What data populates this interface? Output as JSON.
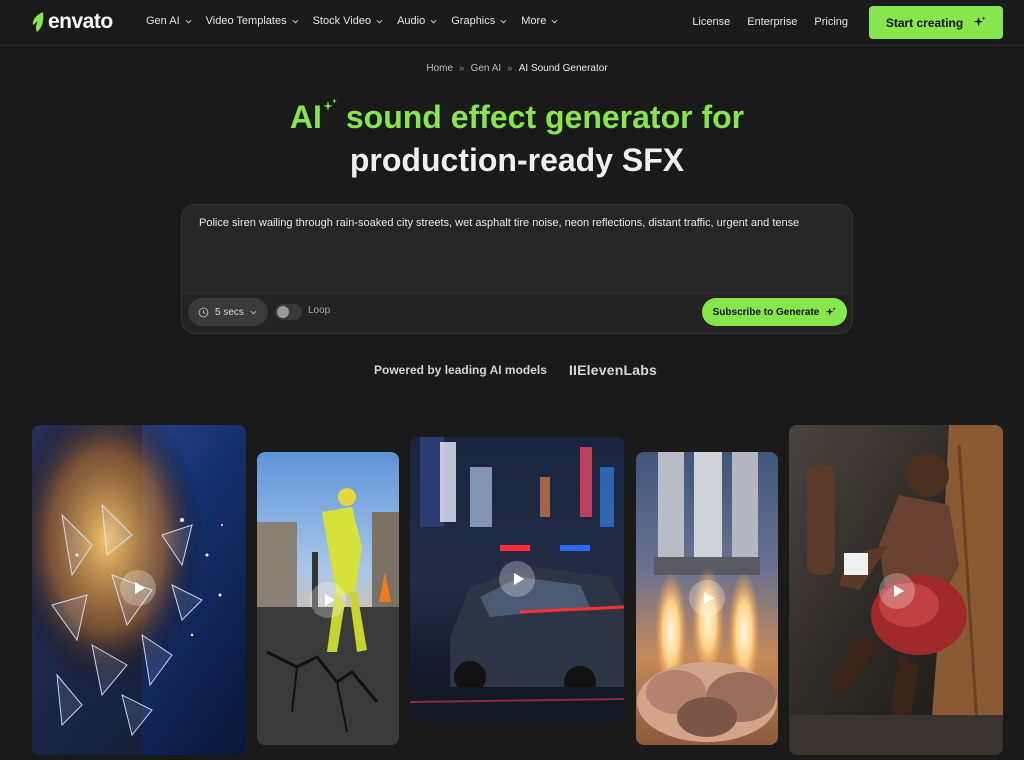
{
  "brand": {
    "name": "envato",
    "accent": "#87e64b"
  },
  "nav": {
    "menu": [
      {
        "label": "Gen AI",
        "icon": "chevron-down-icon"
      },
      {
        "label": "Video Templates",
        "icon": "chevron-down-icon"
      },
      {
        "label": "Stock Video",
        "icon": "chevron-down-icon"
      },
      {
        "label": "Audio",
        "icon": "chevron-down-icon"
      },
      {
        "label": "Graphics",
        "icon": "chevron-down-icon"
      },
      {
        "label": "More",
        "icon": "chevron-down-icon"
      }
    ],
    "links": [
      "License",
      "Enterprise",
      "Pricing"
    ],
    "cta": {
      "label": "Start creating",
      "icon": "sparkle-icon"
    }
  },
  "breadcrumb": {
    "items": [
      "Home",
      "Gen AI",
      "AI Sound Generator"
    ],
    "separator": "»"
  },
  "headline": {
    "line1_a": "AI",
    "line1_b": "sound effect generator for",
    "line2": "production-ready SFX"
  },
  "prompt": {
    "text": "Police siren wailing through rain-soaked city streets, wet asphalt tire noise, neon reflections, distant traffic, urgent and tense",
    "duration": "5 secs",
    "loop_label": "Loop",
    "loop_enabled": false,
    "generate_label": "Subscribe to Generate"
  },
  "powered": {
    "text": "Powered by leading AI models",
    "partner": "IIElevenLabs"
  },
  "media_cards": [
    {
      "subject": "shattering glass",
      "icon": "play-icon"
    },
    {
      "subject": "worker with jackhammer",
      "icon": "play-icon"
    },
    {
      "subject": "police car in neon city",
      "icon": "play-icon"
    },
    {
      "subject": "rocket launch",
      "icon": "play-icon"
    },
    {
      "subject": "boxer punching bag",
      "icon": "play-icon"
    }
  ]
}
